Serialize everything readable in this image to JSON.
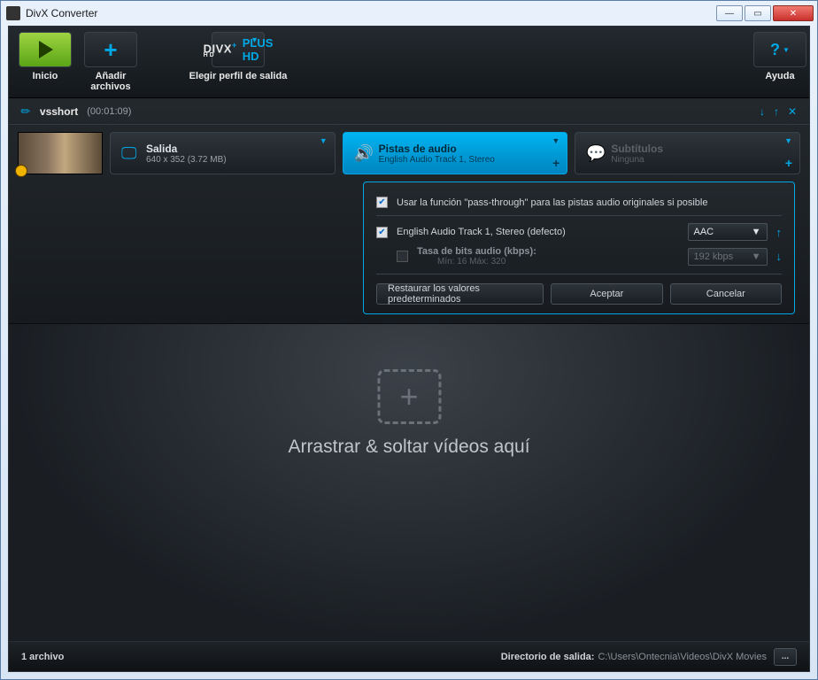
{
  "window": {
    "title": "DivX Converter"
  },
  "toolbar": {
    "start": "Inicio",
    "add": "Añadir archivos",
    "profile_label": "Elegir perfil de salida",
    "profile_brand": "DIVX",
    "profile_hd": "HD",
    "profile_name": "PLUS HD",
    "help": "Ayuda",
    "help_icon": "?"
  },
  "file": {
    "name": "vsshort",
    "duration": "(00:01:09)",
    "output": {
      "title": "Salida",
      "sub": "640 x 352 (3.72 MB)"
    },
    "audio": {
      "title": "Pistas de audio",
      "sub": "English Audio Track 1, Stereo"
    },
    "subs": {
      "title": "Subtítulos",
      "sub": "Ninguna"
    }
  },
  "audio_popup": {
    "passthrough": "Usar la función \"pass-through\" para las pistas audio originales si posible",
    "track": "English Audio Track 1, Stereo  (defecto)",
    "codec": "AAC",
    "bitrate_label": "Tasa de bits audio (kbps):",
    "bitrate_range": "Mín: 16  Máx: 320",
    "bitrate_value": "192 kbps",
    "restore": "Restaurar los valores predeterminados",
    "accept": "Aceptar",
    "cancel": "Cancelar"
  },
  "dropzone": {
    "text": "Arrastrar & soltar vídeos aquí"
  },
  "status": {
    "count": "1 archivo",
    "outdir_label": "Directorio de salida:",
    "outdir_path": "C:\\Users\\Ontecnia\\Videos\\DivX Movies",
    "browse": "..."
  }
}
